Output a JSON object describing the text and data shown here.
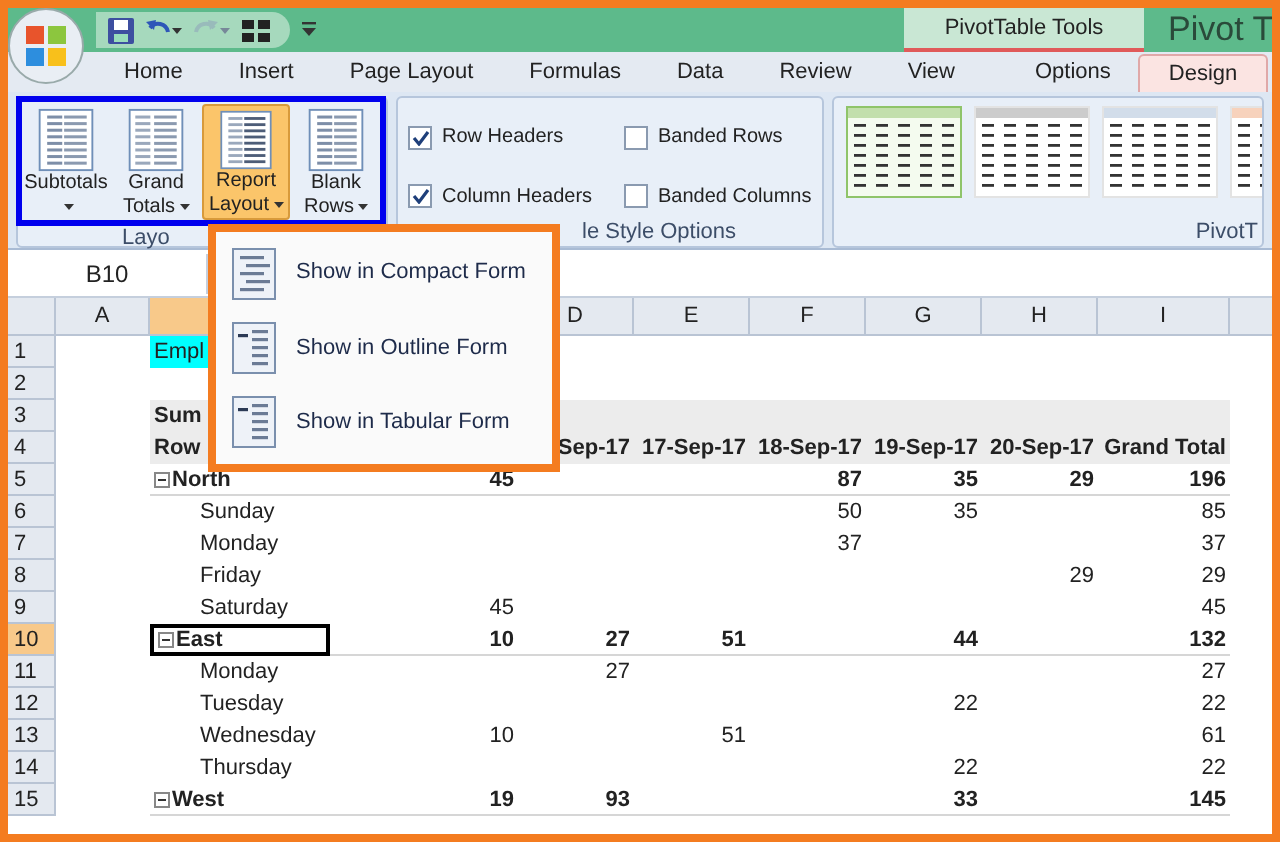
{
  "title_bar": {
    "contextual_label": "PivotTable Tools",
    "title": "Pivot T"
  },
  "tabs": [
    {
      "label": "Home",
      "selected": false
    },
    {
      "label": "Insert",
      "selected": false
    },
    {
      "label": "Page Layout",
      "selected": false
    },
    {
      "label": "Formulas",
      "selected": false
    },
    {
      "label": "Data",
      "selected": false
    },
    {
      "label": "Review",
      "selected": false
    },
    {
      "label": "View",
      "selected": false
    },
    {
      "label": "Options",
      "selected": false
    },
    {
      "label": "Design",
      "selected": true
    }
  ],
  "ribbon": {
    "layout_group": {
      "label": "Layo",
      "buttons": [
        {
          "label": "Subtotals",
          "pressed": false
        },
        {
          "label": "Grand Totals",
          "pressed": false
        },
        {
          "label": "Report Layout",
          "pressed": true
        },
        {
          "label": "Blank Rows",
          "pressed": false
        }
      ]
    },
    "style_options": {
      "label": "le Style Options",
      "options": [
        {
          "label": "Row Headers",
          "checked": true
        },
        {
          "label": "Column Headers",
          "checked": true
        },
        {
          "label": "Banded Rows",
          "checked": false
        },
        {
          "label": "Banded Columns",
          "checked": false
        }
      ]
    },
    "styles_group": {
      "label": "PivotT"
    }
  },
  "name_box": "B10",
  "menu": [
    {
      "label": "Show in Compact Form"
    },
    {
      "label": "Show in Outline Form"
    },
    {
      "label": "Show in Tabular Form"
    }
  ],
  "columns": [
    {
      "kind": "shown",
      "letter": "A",
      "selected": false
    },
    {
      "kind": "hidden",
      "selected": true
    },
    {
      "kind": "hidden"
    },
    {
      "kind": "shown",
      "letter": "D",
      "selected": false
    },
    {
      "kind": "shown",
      "letter": "E",
      "selected": false
    },
    {
      "kind": "shown",
      "letter": "F",
      "selected": false
    },
    {
      "kind": "shown",
      "letter": "G",
      "selected": false
    },
    {
      "kind": "shown",
      "letter": "H",
      "selected": false
    },
    {
      "kind": "shown",
      "letter": "I",
      "selected": false
    }
  ],
  "rows": [
    {
      "num": "1",
      "kind": "title",
      "selected": false,
      "label": "Empl"
    },
    {
      "num": "2",
      "kind": "blank",
      "selected": false
    },
    {
      "num": "3",
      "kind": "header",
      "selected": false,
      "label": "Sum"
    },
    {
      "num": "4",
      "kind": "header",
      "selected": false,
      "label": "Row",
      "values": {
        "D": "Sep-17",
        "E": "17-Sep-17",
        "F": "18-Sep-17",
        "G": "19-Sep-17",
        "H": "20-Sep-17",
        "I": "Grand Total"
      }
    },
    {
      "num": "5",
      "kind": "group",
      "selected": false,
      "expanded": true,
      "label": "North",
      "values": {
        "C": "45",
        "F": "87",
        "G": "35",
        "H": "29",
        "I": "196"
      }
    },
    {
      "num": "6",
      "kind": "item",
      "selected": false,
      "label": "Sunday",
      "values": {
        "F": "50",
        "G": "35",
        "I": "85"
      }
    },
    {
      "num": "7",
      "kind": "item",
      "selected": false,
      "label": "Monday",
      "values": {
        "F": "37",
        "I": "37"
      }
    },
    {
      "num": "8",
      "kind": "item",
      "selected": false,
      "label": "Friday",
      "values": {
        "H": "29",
        "I": "29"
      }
    },
    {
      "num": "9",
      "kind": "item",
      "selected": false,
      "label": "Saturday",
      "values": {
        "C": "45",
        "I": "45"
      }
    },
    {
      "num": "10",
      "kind": "group",
      "selected": true,
      "expanded": true,
      "label": "East",
      "values": {
        "C": "10",
        "D": "27",
        "E": "51",
        "G": "44",
        "I": "132"
      }
    },
    {
      "num": "11",
      "kind": "item",
      "selected": false,
      "label": "Monday",
      "values": {
        "D": "27",
        "I": "27"
      }
    },
    {
      "num": "12",
      "kind": "item",
      "selected": false,
      "label": "Tuesday",
      "values": {
        "G": "22",
        "I": "22"
      }
    },
    {
      "num": "13",
      "kind": "item",
      "selected": false,
      "label": "Wednesday",
      "values": {
        "C": "10",
        "E": "51",
        "I": "61"
      }
    },
    {
      "num": "14",
      "kind": "item",
      "selected": false,
      "label": "Thursday",
      "values": {
        "G": "22",
        "I": "22"
      }
    },
    {
      "num": "15",
      "kind": "group",
      "selected": false,
      "expanded": true,
      "label": "West",
      "values": {
        "C": "19",
        "D": "93",
        "G": "33",
        "I": "145"
      }
    }
  ]
}
